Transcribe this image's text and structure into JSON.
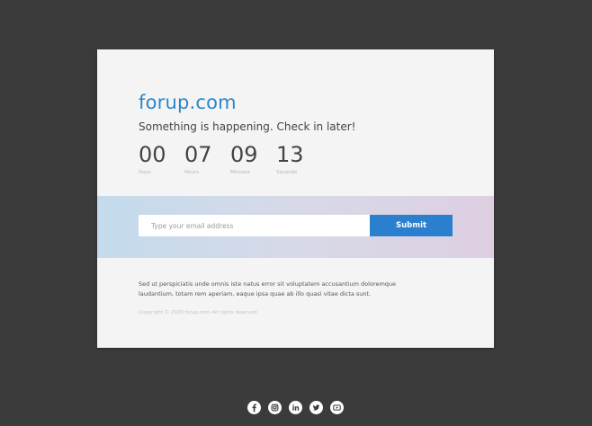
{
  "brand": {
    "name": "forup.com",
    "color": "#2b86c9"
  },
  "headline": "Something is happening. Check in later!",
  "countdown": [
    {
      "value": "00",
      "label": "Days"
    },
    {
      "value": "07",
      "label": "Hours"
    },
    {
      "value": "09",
      "label": "Minutes"
    },
    {
      "value": "13",
      "label": "Seconds"
    }
  ],
  "subscribe": {
    "placeholder": "Type your email address",
    "value": "",
    "button_label": "Submit",
    "button_color": "#2b7fcf"
  },
  "description": "Sed ut perspiciatis unde omnis iste natus error sit voluptatem accusantium doloremque laudantium, totam rem aperiam, eaque ipsa quae ab illo quasi vitae dicta sunt.",
  "copyright": "Copyright © 2020 forup.com All rights reserved",
  "social": [
    {
      "icon": "facebook-icon"
    },
    {
      "icon": "instagram-icon"
    },
    {
      "icon": "linkedin-icon"
    },
    {
      "icon": "twitter-icon"
    },
    {
      "icon": "youtube-icon"
    }
  ],
  "colors": {
    "background": "#3b3b3b",
    "card": "#f4f4f4"
  }
}
